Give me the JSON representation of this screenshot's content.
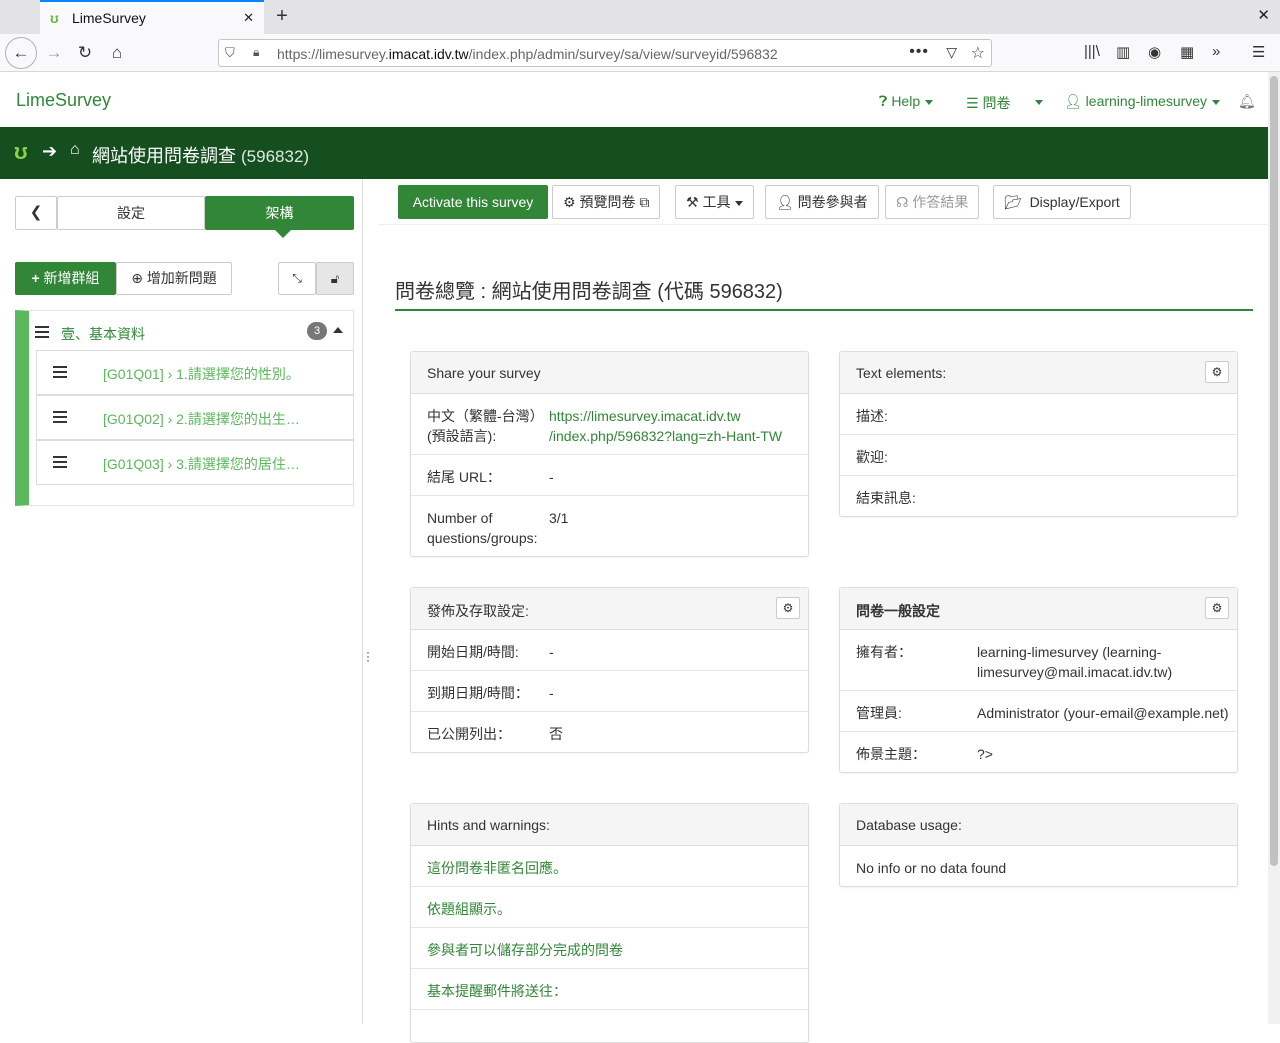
{
  "browser": {
    "tab_title": "LimeSurvey",
    "url_prefix": "https://limesurvey.",
    "url_domain": "imacat.idv.tw",
    "url_path": "/index.php/admin/survey/sa/view/surveyid/596832"
  },
  "topnav": {
    "brand": "LimeSurvey",
    "help": "Help",
    "surveys": "問卷",
    "user": "learning-limesurvey"
  },
  "titlebar": {
    "title": "網站使用問卷調查",
    "survey_id": "(596832)"
  },
  "sidebar": {
    "settings_tab": "設定",
    "structure_tab": "架構",
    "add_group": "新增群組",
    "add_question": "增加新問題",
    "group": {
      "title": "壹、基本資料",
      "count": "3",
      "questions": [
        {
          "label": "[G01Q01] › 1.請選擇您的性別。"
        },
        {
          "label": "[G01Q02] › 2.請選擇您的出生…"
        },
        {
          "label": "[G01Q03] › 3.請選擇您的居住…"
        }
      ]
    }
  },
  "toolbar": {
    "activate": "Activate this survey",
    "preview": "預覽問卷",
    "tools": "工具",
    "participants": "問卷參與者",
    "responses": "作答結果",
    "display_export": "Display/Export"
  },
  "heading": "問卷總覽 : 網站使用問卷調查 (代碼 596832)",
  "share_panel": {
    "title": "Share your survey",
    "lang_label_1": "中文（繁體-台灣）",
    "lang_label_2": "(預設語言):",
    "link_1": "https://limesurvey.imacat.idv.tw",
    "link_2": "/index.php/596832?lang=zh-Hant-TW",
    "end_url_label": "結尾 URL：",
    "end_url_value": "-",
    "count_label_1": "Number of",
    "count_label_2": "questions/groups:",
    "count_value": "3/1"
  },
  "text_panel": {
    "title": "Text elements:",
    "description": "描述:",
    "welcome": "歡迎:",
    "end_message": "結束訊息:"
  },
  "publish_panel": {
    "title": "發佈及存取設定:",
    "start_label": "開始日期/時間:",
    "start_value": "-",
    "expiry_label": "到期日期/時間：",
    "expiry_value": "-",
    "public_label": "已公開列出：",
    "public_value": "否"
  },
  "general_panel": {
    "title": "問卷一般設定",
    "owner_label": "擁有者：",
    "owner_value_1": "learning-limesurvey (learning-",
    "owner_value_2": "limesurvey@mail.imacat.idv.tw)",
    "admin_label": "管理員:",
    "admin_value": "Administrator (your-email@example.net)",
    "theme_label": "佈景主題：",
    "theme_value": "?>"
  },
  "hints_panel": {
    "title": "Hints and warnings:",
    "items": [
      "這份問卷非匿名回應。",
      "依題組顯示。",
      "參與者可以儲存部分完成的問卷",
      "基本提醒郵件將送往："
    ]
  },
  "db_panel": {
    "title": "Database usage:",
    "value": "No info or no data found"
  },
  "colors": {
    "brand_green": "#328637",
    "dark_green": "#164f1f",
    "light_green": "#5cb85c"
  }
}
